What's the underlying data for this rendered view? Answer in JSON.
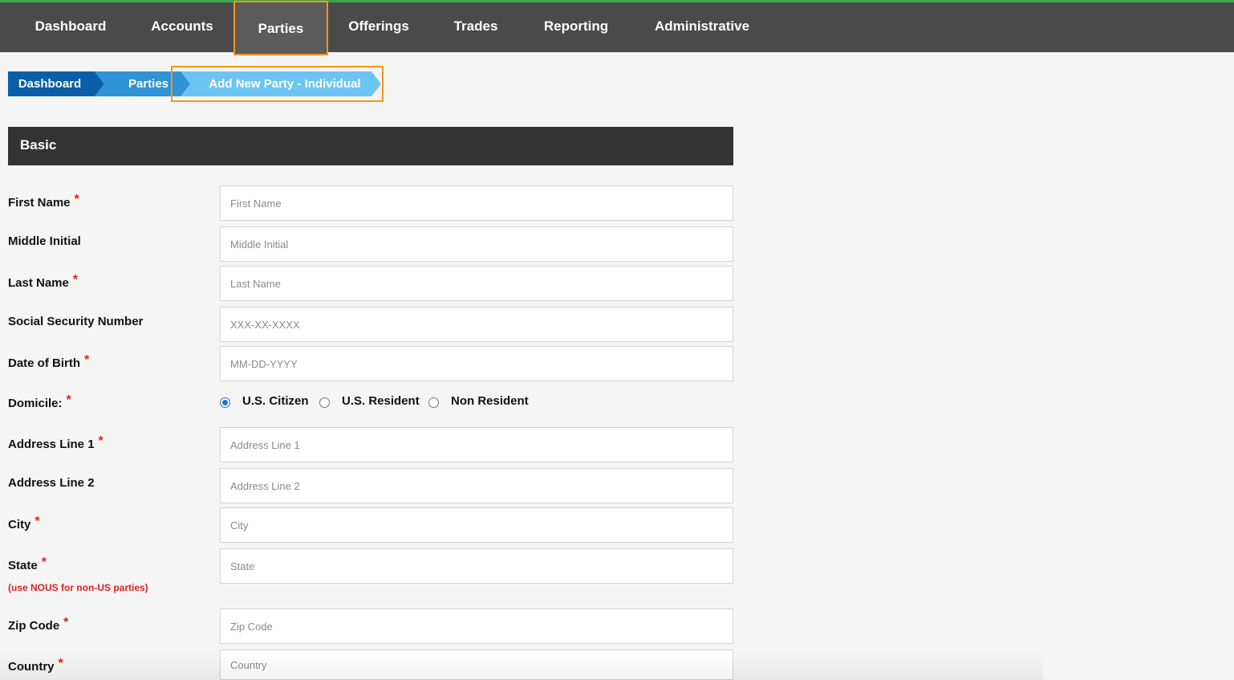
{
  "nav": {
    "items": [
      {
        "label": "Dashboard"
      },
      {
        "label": "Accounts"
      },
      {
        "label": "Parties"
      },
      {
        "label": "Offerings"
      },
      {
        "label": "Trades"
      },
      {
        "label": "Reporting"
      },
      {
        "label": "Administrative"
      }
    ],
    "active": "Parties"
  },
  "breadcrumb": {
    "items": [
      {
        "label": "Dashboard"
      },
      {
        "label": "Parties"
      },
      {
        "label": "Add New Party - Individual"
      }
    ]
  },
  "section": {
    "title": "Basic"
  },
  "form": {
    "first_name": {
      "label": "First Name",
      "required": "*",
      "placeholder": "First Name"
    },
    "middle_initial": {
      "label": "Middle Initial",
      "placeholder": "Middle Initial"
    },
    "last_name": {
      "label": "Last Name",
      "required": "*",
      "placeholder": "Last Name"
    },
    "ssn": {
      "label": "Social Security Number",
      "placeholder": "XXX-XX-XXXX"
    },
    "dob": {
      "label": "Date of Birth",
      "required": "*",
      "placeholder": "MM-DD-YYYY"
    },
    "domicile": {
      "label": "Domicile:",
      "required": "*",
      "options": [
        "U.S. Citizen",
        "U.S. Resident",
        "Non Resident"
      ],
      "selected": "U.S. Citizen"
    },
    "address1": {
      "label": "Address Line 1",
      "required": "*",
      "placeholder": "Address Line 1"
    },
    "address2": {
      "label": "Address Line 2",
      "placeholder": "Address Line 2"
    },
    "city": {
      "label": "City",
      "required": "*",
      "placeholder": "City"
    },
    "state": {
      "label": "State",
      "required": "*",
      "placeholder": "State",
      "hint": "(use NOUS for non-US parties)"
    },
    "zip": {
      "label": "Zip Code",
      "required": "*",
      "placeholder": "Zip Code"
    },
    "country": {
      "label": "Country",
      "required": "*",
      "placeholder": "Country"
    }
  },
  "colors": {
    "nav_bg": "#4a4a4a",
    "nav_accent_top": "#3fa64a",
    "highlight_orange": "#f7941d",
    "breadcrumb_1": "#0b5ea8",
    "breadcrumb_2": "#2f93d6",
    "breadcrumb_3": "#6dc4f2",
    "required_red": "#e02020",
    "radio_blue": "#1f6fe0"
  }
}
